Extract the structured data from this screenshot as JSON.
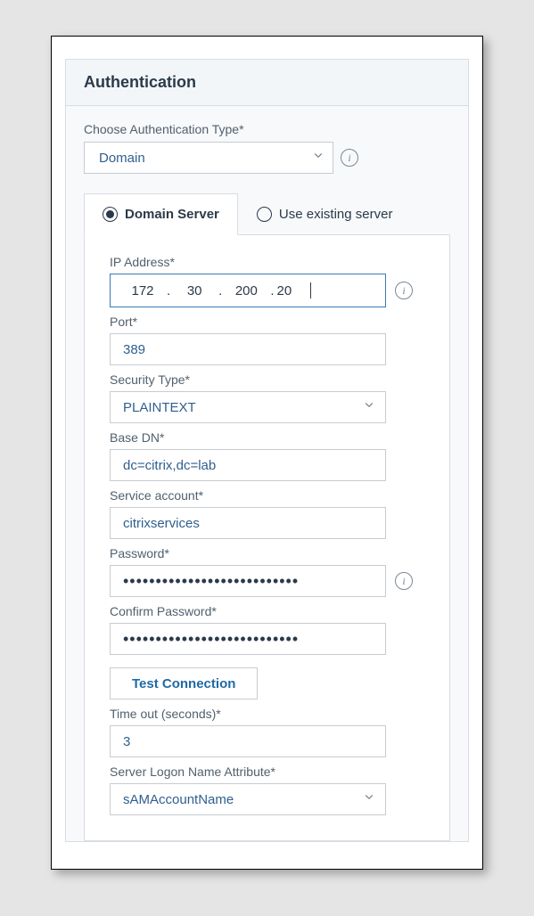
{
  "header": {
    "title": "Authentication"
  },
  "authType": {
    "label": "Choose Authentication Type*",
    "value": "Domain"
  },
  "tabs": {
    "domainServer": "Domain Server",
    "useExisting": "Use existing server"
  },
  "form": {
    "ipAddress": {
      "label": "IP Address*",
      "oct1": "172",
      "oct2": "30",
      "oct3": "200",
      "oct4": "20"
    },
    "port": {
      "label": "Port*",
      "value": "389"
    },
    "securityType": {
      "label": "Security Type*",
      "value": "PLAINTEXT"
    },
    "baseDn": {
      "label": "Base DN*",
      "value": "dc=citrix,dc=lab"
    },
    "serviceAccount": {
      "label": "Service account*",
      "value": "citrixservices"
    },
    "password": {
      "label": "Password*",
      "mask": "•••••••••••••••••••••••••••"
    },
    "confirmPassword": {
      "label": "Confirm Password*",
      "mask": "•••••••••••••••••••••••••••"
    },
    "testConnection": {
      "label": "Test Connection"
    },
    "timeout": {
      "label": "Time out (seconds)*",
      "value": "3"
    },
    "logonAttr": {
      "label": "Server Logon Name Attribute*",
      "value": "sAMAccountName"
    }
  }
}
